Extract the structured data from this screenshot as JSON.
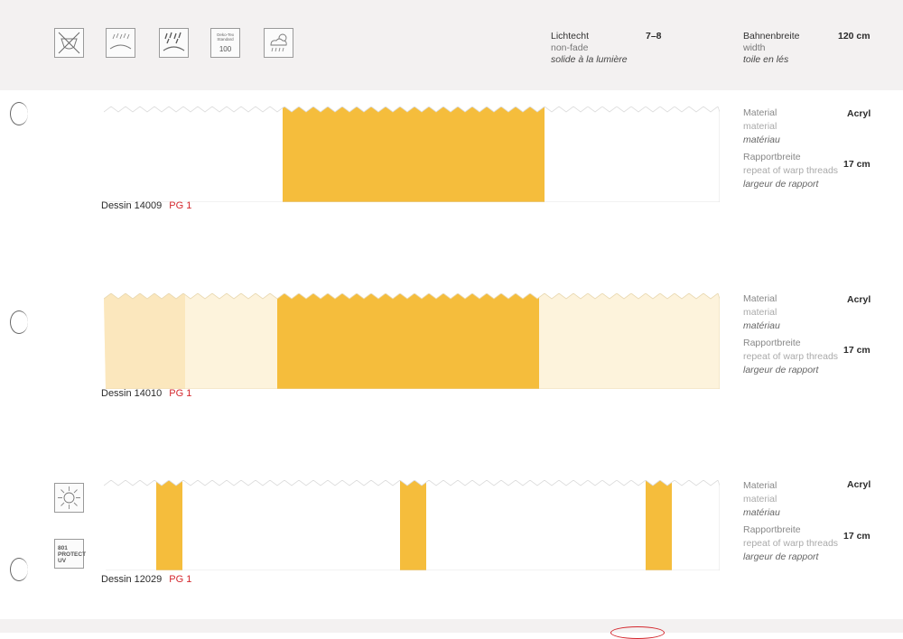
{
  "header": {
    "icons": [
      "no-bleach-icon",
      "dew-resistant-icon",
      "rain-resistant-icon",
      "oeko-tex-icon",
      "weather-icon"
    ],
    "oeko": {
      "top": "Oeko-Tex Standard",
      "number": "100"
    },
    "lightfast": {
      "de": "Lichtecht",
      "en": "non-fade",
      "fr": "solide à la lumière",
      "value": "7–8"
    },
    "width": {
      "de": "Bahnenbreite",
      "en": "width",
      "fr": "toile en lés",
      "value": "120 cm"
    }
  },
  "labels": {
    "material_de": "Material",
    "material_en": "material",
    "material_fr": "matériau",
    "repeat_de": "Rapportbreite",
    "repeat_en": "repeat of warp threads",
    "repeat_fr": "largeur de rapport"
  },
  "samples": [
    {
      "dessin": "Dessin 14009",
      "pg": "PG 1",
      "material": "Acryl",
      "repeat": "17 cm"
    },
    {
      "dessin": "Dessin 14010",
      "pg": "PG 1",
      "material": "Acryl",
      "repeat": "17 cm"
    },
    {
      "dessin": "Dessin 12029",
      "pg": "PG 1",
      "material": "Acryl",
      "repeat": "17 cm"
    }
  ],
  "uv_icon": {
    "line1": "801",
    "line2": "PROTECT",
    "line3": "UV"
  },
  "colors": {
    "accent_red": "#d4282e",
    "stripe_yellow": "#f5bd3c",
    "pale_yellow": "#fbe7bd",
    "band": "#f3f1f1"
  }
}
